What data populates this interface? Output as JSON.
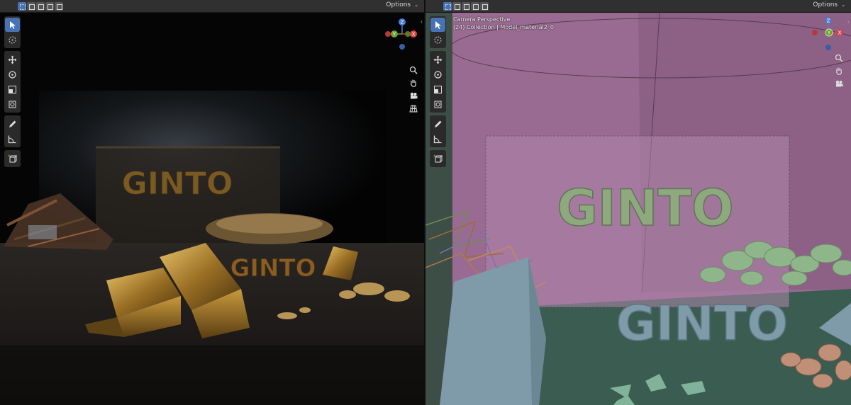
{
  "left_viewport": {
    "header": {
      "options_label": "Options",
      "options_chevron": "⌄"
    },
    "shading": "rendered",
    "scene_text": {
      "wall_text": "GINTO",
      "floor_text": "GINTO"
    },
    "gizmo": {
      "z": "Z",
      "y": "Y",
      "x": "X"
    },
    "toolbar": [
      "select-box",
      "cursor",
      "move",
      "rotate",
      "scale",
      "transform",
      "annotate",
      "measure",
      "add-cube"
    ],
    "nav": [
      "zoom",
      "pan",
      "camera",
      "grid"
    ]
  },
  "right_viewport": {
    "header": {
      "options_label": "Options",
      "options_chevron": "⌄"
    },
    "shading": "solid",
    "info_line1": "Camera Perspective",
    "info_line2": "(24) Collection | Model_material2_0",
    "scene_text": {
      "wall_text": "GINTO",
      "floor_text": "GINTO"
    },
    "gizmo": {
      "z": "Z",
      "y": "Y",
      "x": "X"
    },
    "nav": [
      "zoom",
      "pan",
      "camera"
    ]
  },
  "colors": {
    "accent": "#4772b3",
    "header_bg": "#303030",
    "axis_x": "#e0414a",
    "axis_y": "#6ea12f",
    "axis_z": "#4a7dd6",
    "solid_wall": "#9a6b92",
    "solid_floor": "#3e5e53",
    "solid_text": "#8ea97e"
  }
}
